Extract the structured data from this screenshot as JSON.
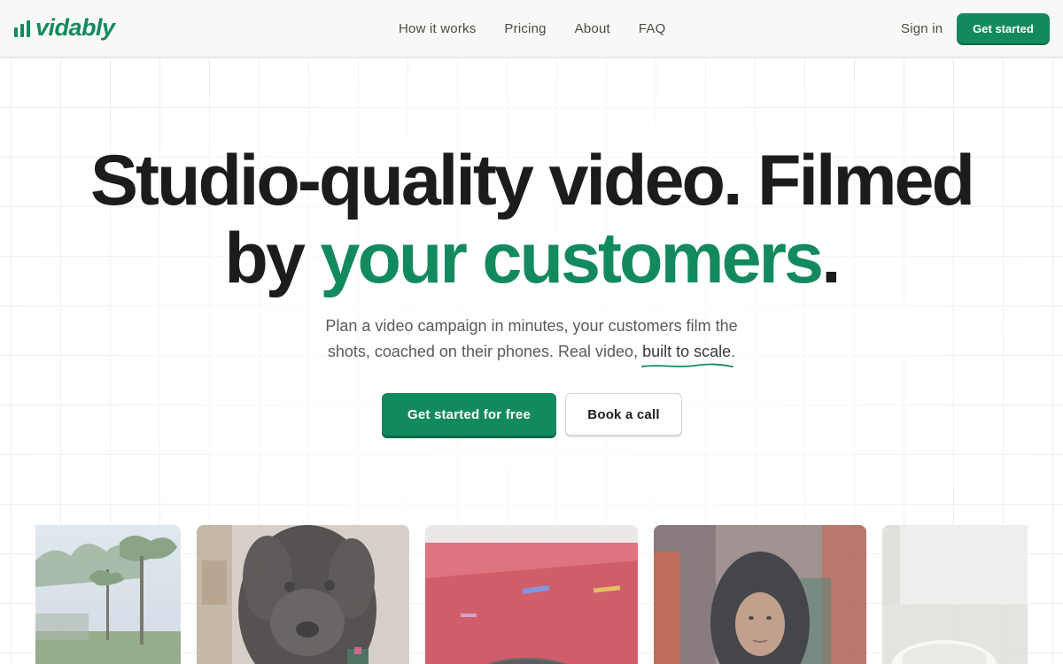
{
  "brand": {
    "name": "vidably",
    "color": "#138a5e"
  },
  "nav": {
    "links": [
      "How it works",
      "Pricing",
      "About",
      "FAQ"
    ],
    "sign_in": "Sign in",
    "cta": "Get started"
  },
  "hero": {
    "title_line1": "Studio-quality video. Filmed",
    "title_line2_prefix": "by ",
    "title_line2_accent": "your customers",
    "title_line2_suffix": ".",
    "subtitle_part1": "Plan a video campaign in minutes, your customers film the shots, coached on their phones. Real video, ",
    "subtitle_underlined": "built to scale",
    "subtitle_end": ".",
    "primary_cta": "Get started for free",
    "secondary_cta": "Book a call"
  },
  "gallery": {
    "items": [
      {
        "subject": "trees-under-sky"
      },
      {
        "subject": "black-curly-dog"
      },
      {
        "subject": "cup-on-red-cloth"
      },
      {
        "subject": "woman-in-dark-hood"
      },
      {
        "subject": "white-cup-blurred"
      }
    ]
  },
  "colors": {
    "accent": "#138a5e",
    "heading": "#1c1c1a",
    "body_text": "#5a5a56",
    "nav_bg": "#f8f8f6"
  }
}
